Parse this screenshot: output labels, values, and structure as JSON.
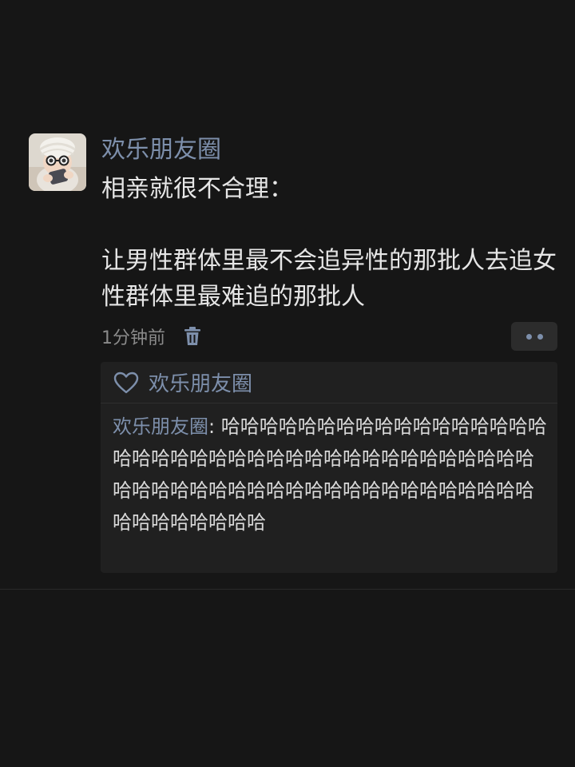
{
  "post": {
    "author": "欢乐朋友圈",
    "content": "相亲就很不合理：\n\n让男性群体里最不会追异性的那批人去追女性群体里最难追的那批人",
    "time": "1分钟前"
  },
  "interaction": {
    "likes": [
      "欢乐朋友圈"
    ],
    "comments": [
      {
        "author": "欢乐朋友圈",
        "separator": ": ",
        "text": "哈哈哈哈哈哈哈哈哈哈哈哈哈哈哈哈哈哈哈哈哈哈哈哈哈哈哈哈哈哈哈哈哈哈哈哈哈哈哈哈哈哈哈哈哈哈哈哈哈哈哈哈哈哈哈哈哈哈哈哈哈哈哈哈哈哈哈哈哈"
      }
    ]
  },
  "icons": {
    "avatar": "avatar-image",
    "delete": "trash-icon",
    "more": "more-dots-icon",
    "like": "heart-outline-icon"
  },
  "colors": {
    "background": "#161616",
    "name_link": "#7d8fab",
    "body_text": "#e6e6e6",
    "muted_text": "#8a8a8a",
    "panel": "#202020"
  }
}
